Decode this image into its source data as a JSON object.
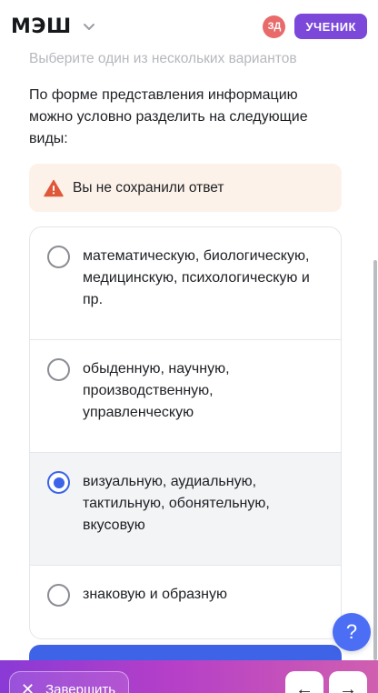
{
  "header": {
    "logo": "МЭШ",
    "avatar_initials": "ЗД",
    "role_label": "УЧЕНИК"
  },
  "task": {
    "hint": "Выберите один из нескольких вариантов",
    "question": "По форме представления информацию можно условно разделить на следующие виды:",
    "warning": "Вы не сохранили ответ"
  },
  "options": [
    {
      "label": "математическую, биологическую, медицинскую, психологическую и пр.",
      "selected": false
    },
    {
      "label": "обыденную, научную, производственную, управленческую",
      "selected": false
    },
    {
      "label": "визуальную, аудиальную, тактильную, обонятельную, вкусовую",
      "selected": true
    },
    {
      "label": "знаковую и образную",
      "selected": false
    }
  ],
  "help": {
    "label": "?"
  },
  "footer": {
    "finish_label": "Завершить",
    "finish_icon": "close-icon",
    "prev_icon": "arrow-left-icon",
    "next_icon": "arrow-right-icon"
  },
  "colors": {
    "accent": "#3c63e8",
    "role_badge": "#7b48d9",
    "avatar": "#e86a6a",
    "warning_bg": "#fdf2e9",
    "warning_icon": "#e0583a"
  }
}
